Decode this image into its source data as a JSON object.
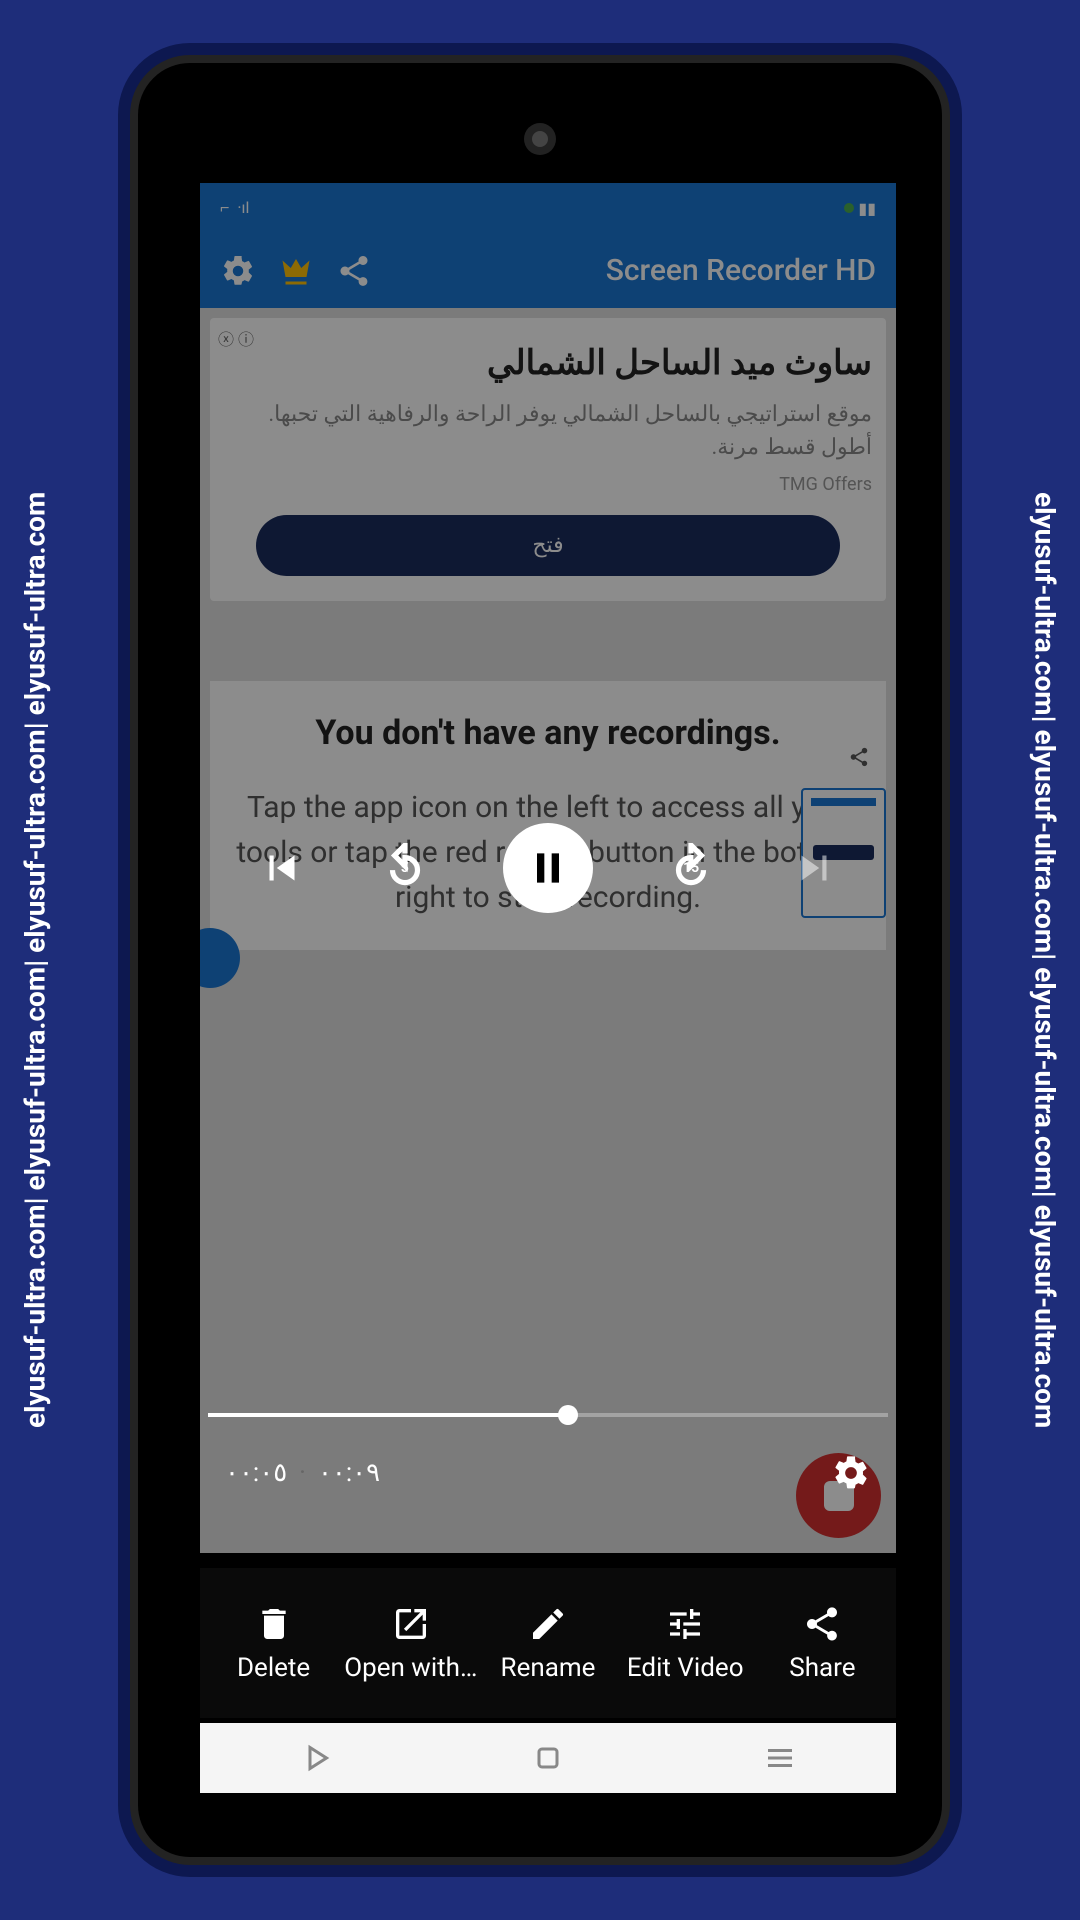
{
  "watermark": "elyusuf-ultra.com| elyusuf-ultra.com| elyusuf-ultra.com| elyusuf-ultra.com",
  "app": {
    "title": "Screen Recorder HD",
    "ad": {
      "title": "ساوث ميد الساحل الشمالي",
      "desc": "موقع استراتيجي بالساحل الشمالي يوفر الراحة والرفاهية التي تحبها. أطول قسط مرنة.",
      "sub": "TMG Offers",
      "button": "فتح"
    },
    "empty": {
      "title": "You don't have any recordings.",
      "text": "Tap the app icon on the left to access all your tools or tap the red record button in the bottom right to start recording."
    }
  },
  "player": {
    "rewind_label": "5",
    "forward_label": "15",
    "current_time": "٠٠:٠٥",
    "sep": "·",
    "duration": "٠٠:٠٩"
  },
  "toolbar": {
    "delete": "Delete",
    "open_with": "Open with…",
    "rename": "Rename",
    "edit_video": "Edit Video",
    "share": "Share"
  }
}
